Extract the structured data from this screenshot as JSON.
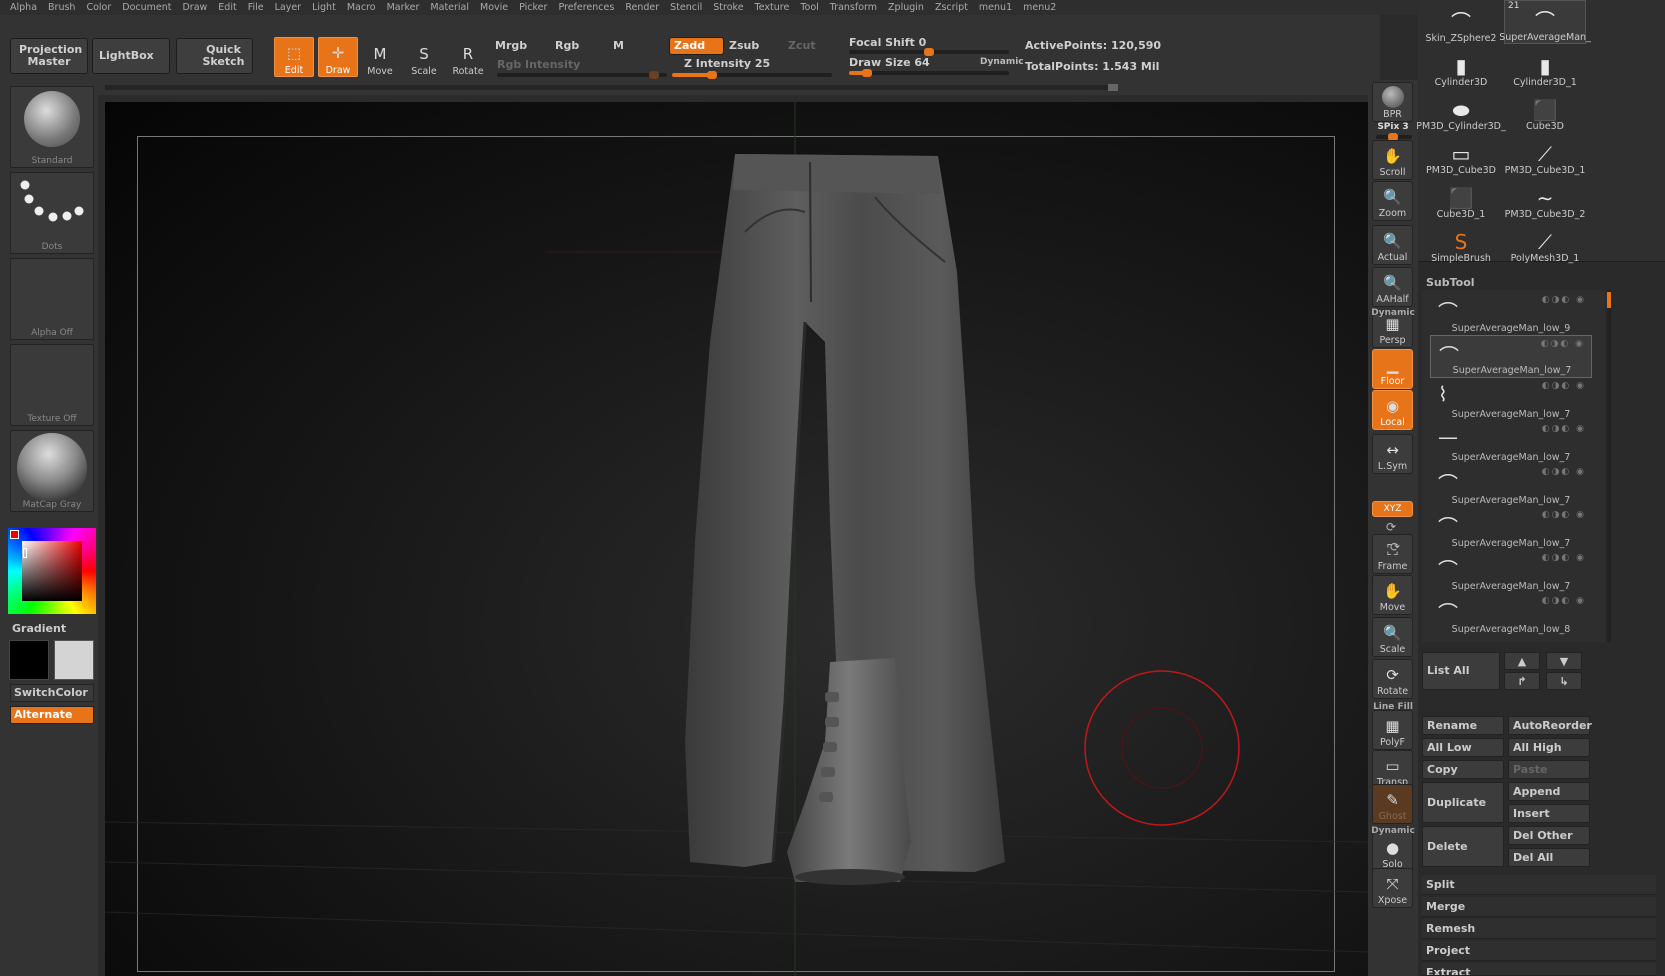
{
  "menu": [
    "Alpha",
    "Brush",
    "Color",
    "Document",
    "Draw",
    "Edit",
    "File",
    "Layer",
    "Light",
    "Macro",
    "Marker",
    "Material",
    "Movie",
    "Picker",
    "Preferences",
    "Render",
    "Stencil",
    "Stroke",
    "Texture",
    "Tool",
    "Transform",
    "Zplugin",
    "Zscript",
    "menu1",
    "menu2"
  ],
  "toolbar": {
    "projection_master": "Projection Master",
    "lightbox": "LightBox",
    "quick_sketch": "Quick Sketch",
    "tools": [
      {
        "label": "Edit",
        "icon": "edit-icon",
        "glyph": "⬚",
        "active": true
      },
      {
        "label": "Draw",
        "icon": "draw-icon",
        "glyph": "✛",
        "active": true
      },
      {
        "label": "Move",
        "icon": "move-icon",
        "glyph": "M",
        "active": false
      },
      {
        "label": "Scale",
        "icon": "scale-icon",
        "glyph": "S",
        "active": false
      },
      {
        "label": "Rotate",
        "icon": "rotate-icon",
        "glyph": "R",
        "active": false
      }
    ],
    "mrgb": "Mrgb",
    "rgb": "Rgb",
    "m": "M",
    "rgb_intensity": "Rgb Intensity",
    "zadd": "Zadd",
    "zsub": "Zsub",
    "zcut": "Zcut",
    "z_intensity": "Z Intensity 25",
    "z_intensity_value": 25,
    "focal_shift": "Focal Shift 0",
    "focal_shift_value": 0,
    "draw_size": "Draw Size 64",
    "draw_size_value": 64,
    "dynamic": "Dynamic",
    "active_points": "ActivePoints: 120,590",
    "total_points": "TotalPoints: 1.543 Mil"
  },
  "left": {
    "brush": "Standard",
    "stroke": "Dots",
    "alpha": "Alpha Off",
    "texture": "Texture Off",
    "material": "MatCap Gray",
    "gradient": "Gradient",
    "switch_color": "SwitchColor",
    "alternate": "Alternate",
    "colors": {
      "main": "#000000",
      "secondary": "#d4d4d4",
      "accent": "#e8741a"
    }
  },
  "shelf": {
    "bpr": "BPR",
    "spix": "SPix 3",
    "buttons": [
      {
        "label": "Scroll",
        "icon": "scroll-icon",
        "glyph": "✋",
        "state": "normal"
      },
      {
        "label": "Zoom",
        "icon": "zoom-icon",
        "glyph": "🔍",
        "state": "normal"
      },
      {
        "label": "Actual",
        "icon": "actual-icon",
        "glyph": "🔍",
        "state": "normal"
      },
      {
        "label": "AAHalf",
        "icon": "aahalf-icon",
        "glyph": "🔍",
        "state": "normal"
      },
      {
        "label": "Persp",
        "icon": "persp-icon",
        "glyph": "▦",
        "state": "normal"
      },
      {
        "label": "Floor",
        "icon": "floor-icon",
        "glyph": "▁",
        "state": "on"
      },
      {
        "label": "Local",
        "icon": "local-icon",
        "glyph": "◉",
        "state": "on"
      },
      {
        "label": "L.Sym",
        "icon": "lsym-icon",
        "glyph": "↔",
        "state": "normal"
      },
      {
        "label": "Frame",
        "icon": "frame-icon",
        "glyph": "⛶",
        "state": "normal"
      },
      {
        "label": "Move",
        "icon": "move-icon",
        "glyph": "✋",
        "state": "normal"
      },
      {
        "label": "Scale",
        "icon": "scale-icon",
        "glyph": "🔍",
        "state": "normal"
      },
      {
        "label": "Rotate",
        "icon": "rotate-icon",
        "glyph": "⟳",
        "state": "normal"
      },
      {
        "label": "PolyF",
        "icon": "polyf-icon",
        "glyph": "▦",
        "state": "normal"
      },
      {
        "label": "Transp",
        "icon": "transp-icon",
        "glyph": "▭",
        "state": "normal"
      },
      {
        "label": "Ghost",
        "icon": "ghost-icon",
        "glyph": "✎",
        "state": "dim"
      },
      {
        "label": "Solo",
        "icon": "solo-icon",
        "glyph": "●",
        "state": "normal"
      },
      {
        "label": "Xpose",
        "icon": "xpose-icon",
        "glyph": "⤧",
        "state": "normal"
      }
    ],
    "dynamic_label": "Dynamic",
    "line_fill": "Line Fill",
    "dynamic_label2": "Dynamic",
    "xyz": "XYZ"
  },
  "meshes": [
    {
      "label": "Skin_ZSphere2",
      "glyph": "⌒"
    },
    {
      "label": "SuperAverageMan_",
      "glyph": "⌒",
      "badge": "21"
    },
    {
      "label": "Cylinder3D",
      "glyph": "▮"
    },
    {
      "label": "Cylinder3D_1",
      "glyph": "▮"
    },
    {
      "label": "PM3D_Cylinder3D_",
      "glyph": "⬬"
    },
    {
      "label": "Cube3D",
      "glyph": "⬛"
    },
    {
      "label": "PM3D_Cube3D",
      "glyph": "▭"
    },
    {
      "label": "PM3D_Cube3D_1",
      "glyph": "⟋"
    },
    {
      "label": "Cube3D_1",
      "glyph": "⬛"
    },
    {
      "label": "PM3D_Cube3D_2",
      "glyph": "∼"
    },
    {
      "label": "SimpleBrush",
      "glyph": "S"
    },
    {
      "label": "PolyMesh3D_1",
      "glyph": "⟋"
    }
  ],
  "subtool": {
    "title": "SubTool",
    "items": [
      {
        "name": "SuperAverageMan_low_9",
        "glyph": "⌒"
      },
      {
        "name": "SuperAverageMan_low_7",
        "glyph": "⌒"
      },
      {
        "name": "SuperAverageMan_low_7",
        "glyph": "⌇"
      },
      {
        "name": "SuperAverageMan_low_7",
        "glyph": "—"
      },
      {
        "name": "SuperAverageMan_low_7",
        "glyph": "⌒"
      },
      {
        "name": "SuperAverageMan_low_7",
        "glyph": "⌒"
      },
      {
        "name": "SuperAverageMan_low_7",
        "glyph": "⌒"
      },
      {
        "name": "SuperAverageMan_low_8",
        "glyph": "⌒"
      }
    ],
    "list_all": "List All",
    "rename": "Rename",
    "auto_reorder": "AutoReorder",
    "all_low": "All Low",
    "all_high": "All High",
    "copy": "Copy",
    "paste": "Paste",
    "duplicate": "Duplicate",
    "append": "Append",
    "insert": "Insert",
    "delete": "Delete",
    "del_other": "Del Other",
    "del_all": "Del All",
    "split": "Split",
    "merge": "Merge",
    "remesh": "Remesh",
    "project": "Project",
    "extract": "Extract"
  }
}
